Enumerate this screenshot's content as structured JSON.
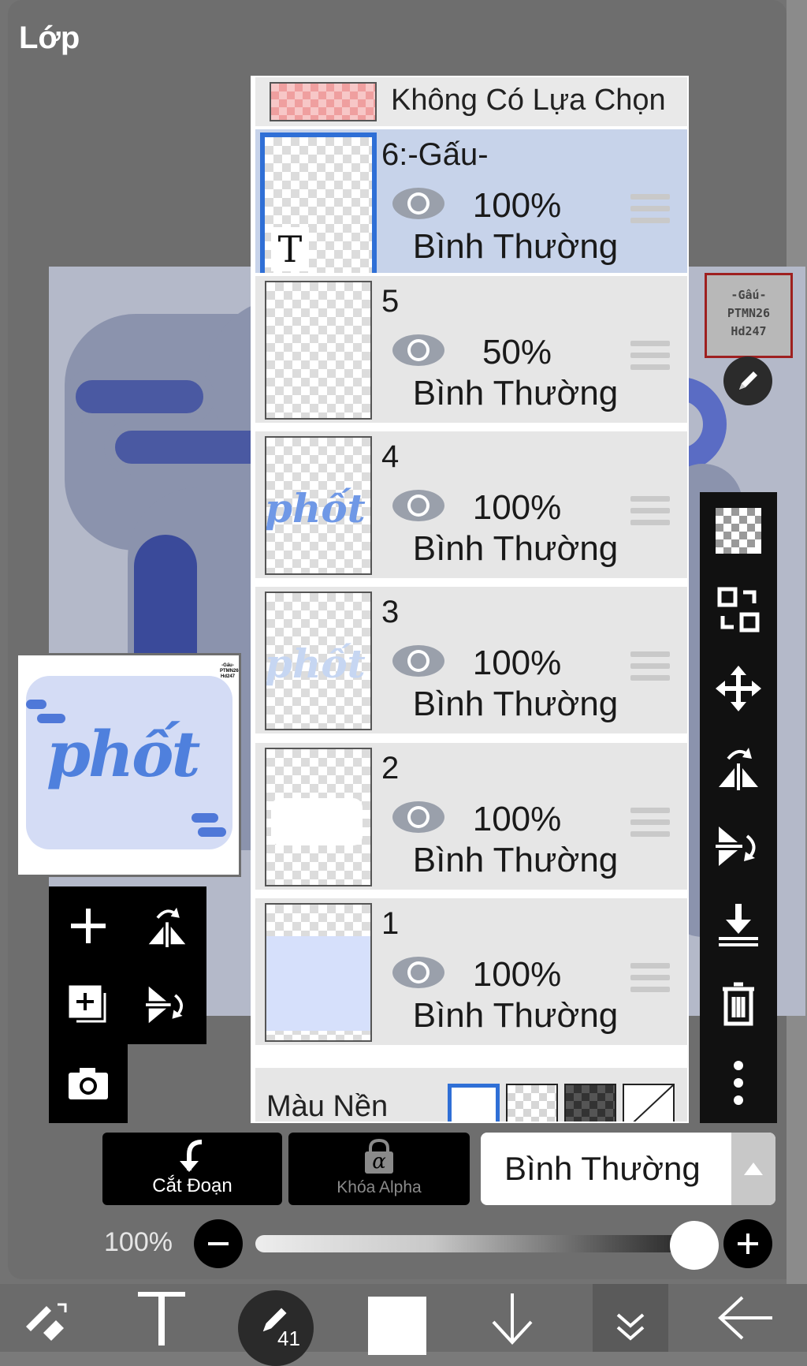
{
  "panel": {
    "title": "Lớp"
  },
  "selection_row": {
    "label": "Không Có Lựa Chọn"
  },
  "layers": [
    {
      "name": "6:-Gấu-",
      "opacity": "100%",
      "blend": "Bình Thường",
      "active": true
    },
    {
      "name": "5",
      "opacity": "50%",
      "blend": "Bình Thường",
      "active": false
    },
    {
      "name": "4",
      "opacity": "100%",
      "blend": "Bình Thường",
      "active": false
    },
    {
      "name": "3",
      "opacity": "100%",
      "blend": "Bình Thường",
      "active": false
    },
    {
      "name": "2",
      "opacity": "100%",
      "blend": "Bình Thường",
      "active": false
    },
    {
      "name": "1",
      "opacity": "100%",
      "blend": "Bình Thường",
      "active": false
    }
  ],
  "thumbnails": {
    "text_marker": "T",
    "artwork_word": "phốt"
  },
  "background_row": {
    "label": "Màu Nền"
  },
  "stamp": {
    "line1": "-Gấu-",
    "line2": "PTMN26",
    "line3": "Hd247"
  },
  "preview": {
    "word": "phốt",
    "tiny_label": "-Gấu- PTMN26 Hd247"
  },
  "bottom_controls": {
    "clip_label": "Cắt Đoạn",
    "alpha_lock_label": "Khóa Alpha",
    "alpha_symbol": "α",
    "blend_mode": "Bình Thường",
    "opacity_label": "100%",
    "opacity_value": 1.0
  },
  "bottom_bar": {
    "brush_size": "41"
  },
  "colors": {
    "accent": "#2f6fd6",
    "active_row": "#c7d3ea",
    "stamp_border": "#9e2020"
  }
}
